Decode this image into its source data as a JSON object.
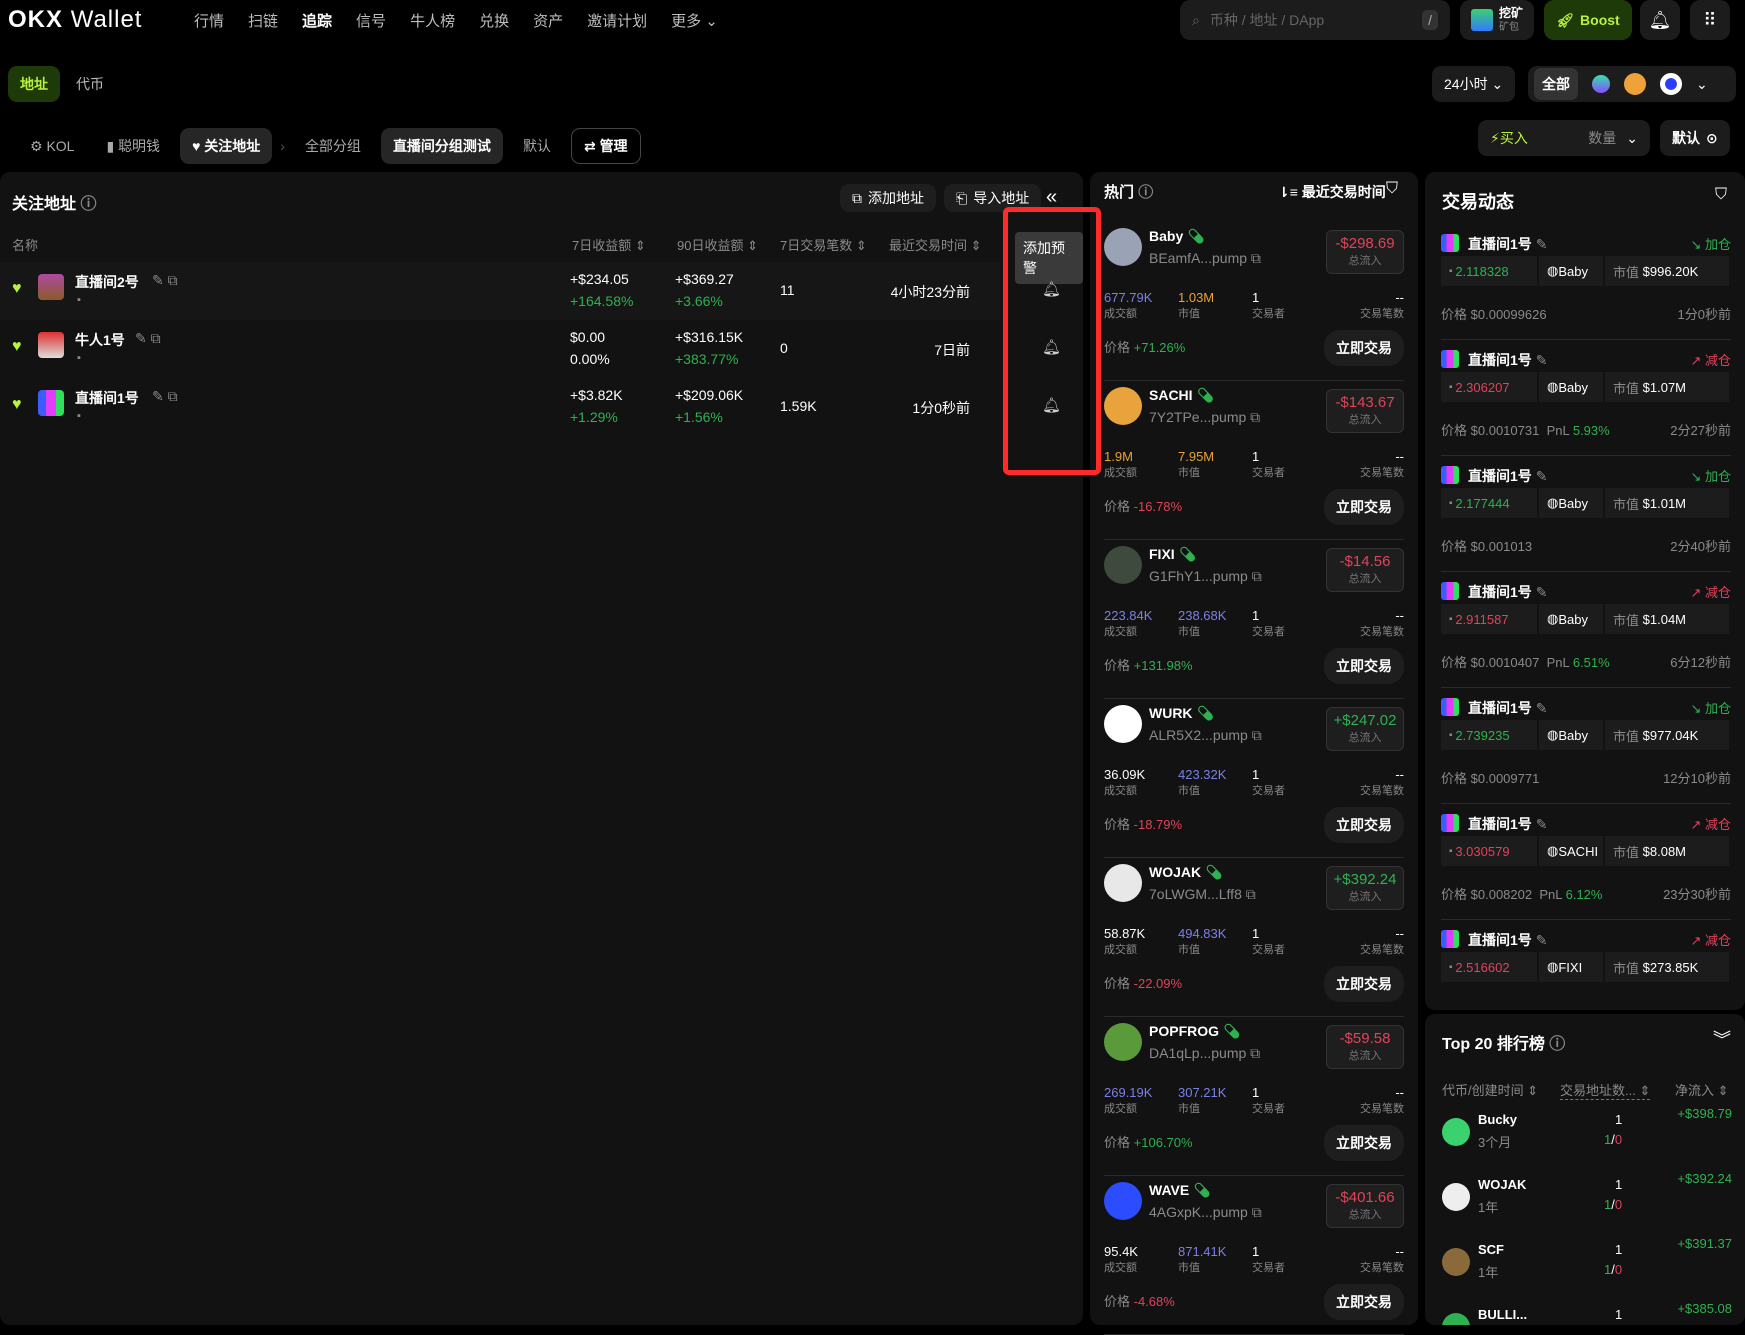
{
  "nav": {
    "logo": "OKX",
    "logo_suffix": "Wallet",
    "items": [
      "行情",
      "扫链",
      "追踪",
      "信号",
      "牛人榜",
      "兑换",
      "资产",
      "邀请计划",
      "更多 ⌄"
    ],
    "search_placeholder": "币种 / 地址 / DApp",
    "search_shortcut": "/",
    "mining_top": "挖矿",
    "mining_bottom": "矿包",
    "boost": "Boost"
  },
  "subnav": {
    "tabs": [
      "地址",
      "代币"
    ],
    "timeframe": "24小时 ⌄",
    "chain_all": "全部"
  },
  "filters": {
    "items": [
      "KOL",
      "聪明钱",
      "关注地址"
    ],
    "groups": [
      "全部分组",
      "直播间分组测试",
      "默认"
    ],
    "manage": "管理",
    "buy": "买入",
    "quantity": "数量",
    "default": "默认"
  },
  "watch": {
    "title": "关注地址",
    "add": "添加地址",
    "import": "导入地址",
    "tooltip": "添加预警",
    "headers": [
      "名称",
      "7日收益额",
      "90日收益额",
      "7日交易笔数",
      "最近交易时间"
    ],
    "rows": [
      {
        "name": "直播间2号",
        "pnl7": "+$234.05",
        "pct7": "+164.58%",
        "pnl90": "+$369.27",
        "pct90": "+3.66%",
        "tx": "11",
        "time": "4小时23分前"
      },
      {
        "name": "牛人1号",
        "pnl7": "$0.00",
        "pct7": "0.00%",
        "pnl90": "+$316.15K",
        "pct90": "+383.77%",
        "tx": "0",
        "time": "7日前"
      },
      {
        "name": "直播间1号",
        "pnl7": "+$3.82K",
        "pct7": "+1.29%",
        "pnl90": "+$209.06K",
        "pct90": "+1.56%",
        "tx": "1.59K",
        "time": "1分0秒前"
      }
    ]
  },
  "hot": {
    "title": "热门",
    "sort": "最近交易时间",
    "flow_label": "总流入",
    "vol_label": "成交额",
    "mc_label": "市值",
    "traders_label": "交易者",
    "txs_label": "交易笔数",
    "price_label": "价格",
    "trade_btn": "立即交易",
    "cards": [
      {
        "name": "Baby",
        "addr": "BEamfA...pump",
        "flow": "-$298.69",
        "vol": "677.79K",
        "mc": "1.03M",
        "traders": "1",
        "txs": "--",
        "chg": "+71.26%",
        "avatar": "#9aa3b5",
        "volc": "pu",
        "mcc": "or",
        "fc": "r",
        "cc": "g"
      },
      {
        "name": "SACHI",
        "addr": "7Y2TPe...pump",
        "flow": "-$143.67",
        "vol": "1.9M",
        "mc": "7.95M",
        "traders": "1",
        "txs": "--",
        "chg": "-16.78%",
        "avatar": "#e8a33c",
        "volc": "or",
        "mcc": "or",
        "fc": "r",
        "cc": "r"
      },
      {
        "name": "FIXI",
        "addr": "G1FhY1...pump",
        "flow": "-$14.56",
        "vol": "223.84K",
        "mc": "238.68K",
        "traders": "1",
        "txs": "--",
        "chg": "+131.98%",
        "avatar": "#3d4a3d",
        "volc": "pu",
        "mcc": "pu",
        "fc": "r",
        "cc": "g"
      },
      {
        "name": "WURK",
        "addr": "ALR5X2...pump",
        "flow": "+$247.02",
        "vol": "36.09K",
        "mc": "423.32K",
        "traders": "1",
        "txs": "--",
        "chg": "-18.79%",
        "avatar": "#ffffff",
        "volc": "",
        "mcc": "pu",
        "fc": "g",
        "cc": "r"
      },
      {
        "name": "WOJAK",
        "addr": "7oLWGM...Lff8",
        "flow": "+$392.24",
        "vol": "58.87K",
        "mc": "494.83K",
        "traders": "1",
        "txs": "--",
        "chg": "-22.09%",
        "avatar": "#e8e8e8",
        "volc": "",
        "mcc": "pu",
        "fc": "g",
        "cc": "r"
      },
      {
        "name": "POPFROG",
        "addr": "DA1qLp...pump",
        "flow": "-$59.58",
        "vol": "269.19K",
        "mc": "307.21K",
        "traders": "1",
        "txs": "--",
        "chg": "+106.70%",
        "avatar": "#5a9a3a",
        "volc": "pu",
        "mcc": "pu",
        "fc": "r",
        "cc": "g"
      },
      {
        "name": "WAVE",
        "addr": "4AGxpK...pump",
        "flow": "-$401.66",
        "vol": "95.4K",
        "mc": "871.41K",
        "traders": "1",
        "txs": "--",
        "chg": "-4.68%",
        "avatar": "#2b4cff",
        "volc": "",
        "mcc": "pu",
        "fc": "r",
        "cc": "r"
      }
    ]
  },
  "activity": {
    "title": "交易动态",
    "mc_label": "市值",
    "price_label": "价格",
    "pnl_label": "PnL",
    "events": [
      {
        "user": "直播间1号",
        "action": "↘ 加仓",
        "ac": "g",
        "amount": "2.118328",
        "token": "Baby",
        "mc": "$996.20K",
        "price": "$0.00099626",
        "pnl": "",
        "time": "1分0秒前"
      },
      {
        "user": "直播间1号",
        "action": "↗ 减仓",
        "ac": "r",
        "amount": "2.306207",
        "token": "Baby",
        "mc": "$1.07M",
        "price": "$0.0010731",
        "pnl": "5.93%",
        "time": "2分27秒前"
      },
      {
        "user": "直播间1号",
        "action": "↘ 加仓",
        "ac": "g",
        "amount": "2.177444",
        "token": "Baby",
        "mc": "$1.01M",
        "price": "$0.001013",
        "pnl": "",
        "time": "2分40秒前"
      },
      {
        "user": "直播间1号",
        "action": "↗ 减仓",
        "ac": "r",
        "amount": "2.911587",
        "token": "Baby",
        "mc": "$1.04M",
        "price": "$0.0010407",
        "pnl": "6.51%",
        "time": "6分12秒前"
      },
      {
        "user": "直播间1号",
        "action": "↘ 加仓",
        "ac": "g",
        "amount": "2.739235",
        "token": "Baby",
        "mc": "$977.04K",
        "price": "$0.0009771",
        "pnl": "",
        "time": "12分10秒前"
      },
      {
        "user": "直播间1号",
        "action": "↗ 减仓",
        "ac": "r",
        "amount": "3.030579",
        "token": "SACHI",
        "mc": "$8.08M",
        "price": "$0.008202",
        "pnl": "6.12%",
        "time": "23分30秒前"
      },
      {
        "user": "直播间1号",
        "action": "↗ 减仓",
        "ac": "r",
        "amount": "2.516602",
        "token": "FIXI",
        "mc": "$273.85K",
        "price": "",
        "pnl": "",
        "time": ""
      }
    ]
  },
  "top20": {
    "title": "Top 20 排行榜",
    "headers": [
      "代币/创建时间",
      "交易地址数...",
      "净流入"
    ],
    "rows": [
      {
        "name": "Bucky",
        "age": "3个月",
        "count": "1",
        "buy": "1",
        "sell": "0",
        "net": "+$398.79"
      },
      {
        "name": "WOJAK",
        "age": "1年",
        "count": "1",
        "buy": "1",
        "sell": "0",
        "net": "+$392.24"
      },
      {
        "name": "SCF",
        "age": "1年",
        "count": "1",
        "buy": "1",
        "sell": "0",
        "net": "+$391.37"
      },
      {
        "name": "BULLI...",
        "age": "",
        "count": "1",
        "buy": "",
        "sell": "",
        "net": "+$385.08"
      }
    ]
  },
  "colors": {
    "accent": "#b8f23a",
    "up": "#2fb14f",
    "down": "#e0435a",
    "highlight": "#ff2b2b"
  }
}
